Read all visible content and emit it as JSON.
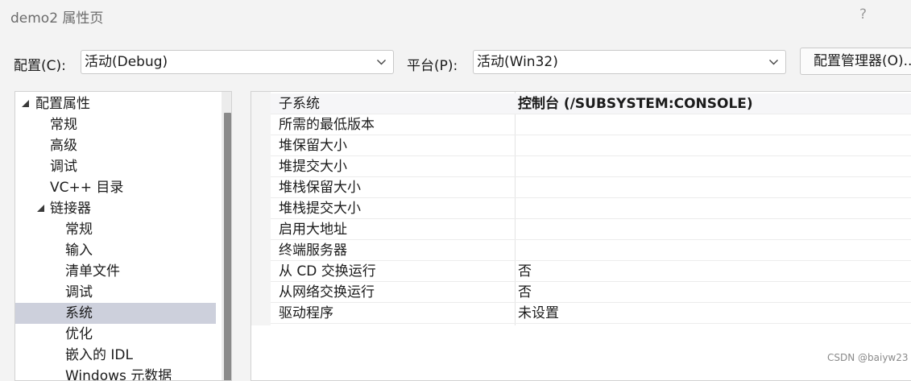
{
  "window": {
    "title": "demo2 属性页",
    "help": "?"
  },
  "toolbar": {
    "config_label": "配置(C):",
    "config_value": "活动(Debug)",
    "platform_label": "平台(P):",
    "platform_value": "活动(Win32)",
    "config_manager_button": "配置管理器(O)..."
  },
  "tree": {
    "items": [
      {
        "label": "配置属性",
        "selected": false
      },
      {
        "label": "常规",
        "selected": false
      },
      {
        "label": "高级",
        "selected": false
      },
      {
        "label": "调试",
        "selected": false
      },
      {
        "label": "VC++ 目录",
        "selected": false
      },
      {
        "label": "链接器",
        "selected": false
      },
      {
        "label": "常规",
        "selected": false
      },
      {
        "label": "输入",
        "selected": false
      },
      {
        "label": "清单文件",
        "selected": false
      },
      {
        "label": "调试",
        "selected": false
      },
      {
        "label": "系统",
        "selected": true
      },
      {
        "label": "优化",
        "selected": false
      },
      {
        "label": "嵌入的 IDL",
        "selected": false
      },
      {
        "label": "Windows 元数据",
        "selected": false
      }
    ]
  },
  "properties": {
    "rows": [
      {
        "name": "子系统",
        "value": "控制台 (/SUBSYSTEM:CONSOLE)"
      },
      {
        "name": "所需的最低版本",
        "value": ""
      },
      {
        "name": "堆保留大小",
        "value": ""
      },
      {
        "name": "堆提交大小",
        "value": ""
      },
      {
        "name": "堆栈保留大小",
        "value": ""
      },
      {
        "name": "堆栈提交大小",
        "value": ""
      },
      {
        "name": "启用大地址",
        "value": ""
      },
      {
        "name": "终端服务器",
        "value": ""
      },
      {
        "name": "从 CD 交换运行",
        "value": "否"
      },
      {
        "name": "从网络交换运行",
        "value": "否"
      },
      {
        "name": "驱动程序",
        "value": "未设置"
      }
    ]
  },
  "watermark": "CSDN @baiyw23",
  "colors": {
    "selection": "#cdd0dc",
    "background": "#f3f3f3"
  }
}
